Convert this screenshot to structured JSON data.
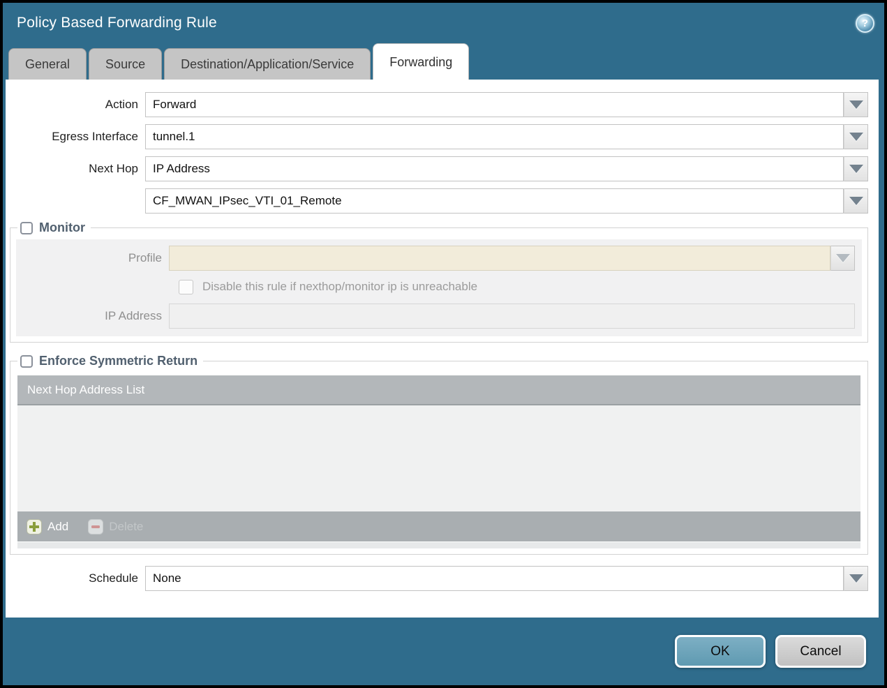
{
  "window": {
    "title": "Policy Based Forwarding Rule",
    "help_glyph": "?"
  },
  "tabs": [
    {
      "label": "General",
      "active": false
    },
    {
      "label": "Source",
      "active": false
    },
    {
      "label": "Destination/Application/Service",
      "active": false
    },
    {
      "label": "Forwarding",
      "active": true
    }
  ],
  "form": {
    "action": {
      "label": "Action",
      "value": "Forward"
    },
    "egress_interface": {
      "label": "Egress Interface",
      "value": "tunnel.1"
    },
    "next_hop": {
      "label": "Next Hop",
      "value": "IP Address"
    },
    "next_hop_address": {
      "value": "CF_MWAN_IPsec_VTI_01_Remote"
    },
    "monitor": {
      "label": "Monitor",
      "checked": false,
      "profile": {
        "label": "Profile",
        "value": ""
      },
      "disable_rule": {
        "label": "Disable this rule if nexthop/monitor ip is unreachable",
        "checked": false
      },
      "ip_address": {
        "label": "IP Address",
        "value": ""
      }
    },
    "enforce_symmetric_return": {
      "label": "Enforce Symmetric Return",
      "checked": false,
      "table": {
        "header": "Next Hop Address List",
        "rows": []
      },
      "add_label": "Add",
      "delete_label": "Delete"
    },
    "schedule": {
      "label": "Schedule",
      "value": "None"
    }
  },
  "footer": {
    "ok_label": "OK",
    "cancel_label": "Cancel"
  },
  "colors": {
    "titlebar_teal": "#2f6c8c",
    "active_tab": "#ffffff",
    "inactive_tab": "#c5c5c5",
    "legend_text": "#51606f",
    "profile_disabled_bg": "#f2ecda",
    "table_header_bg": "#b3b7ba",
    "ok_button": "#6aa2b8",
    "add_plus_green": "#8a9e3c",
    "delete_minus_red": "#cf9494"
  }
}
